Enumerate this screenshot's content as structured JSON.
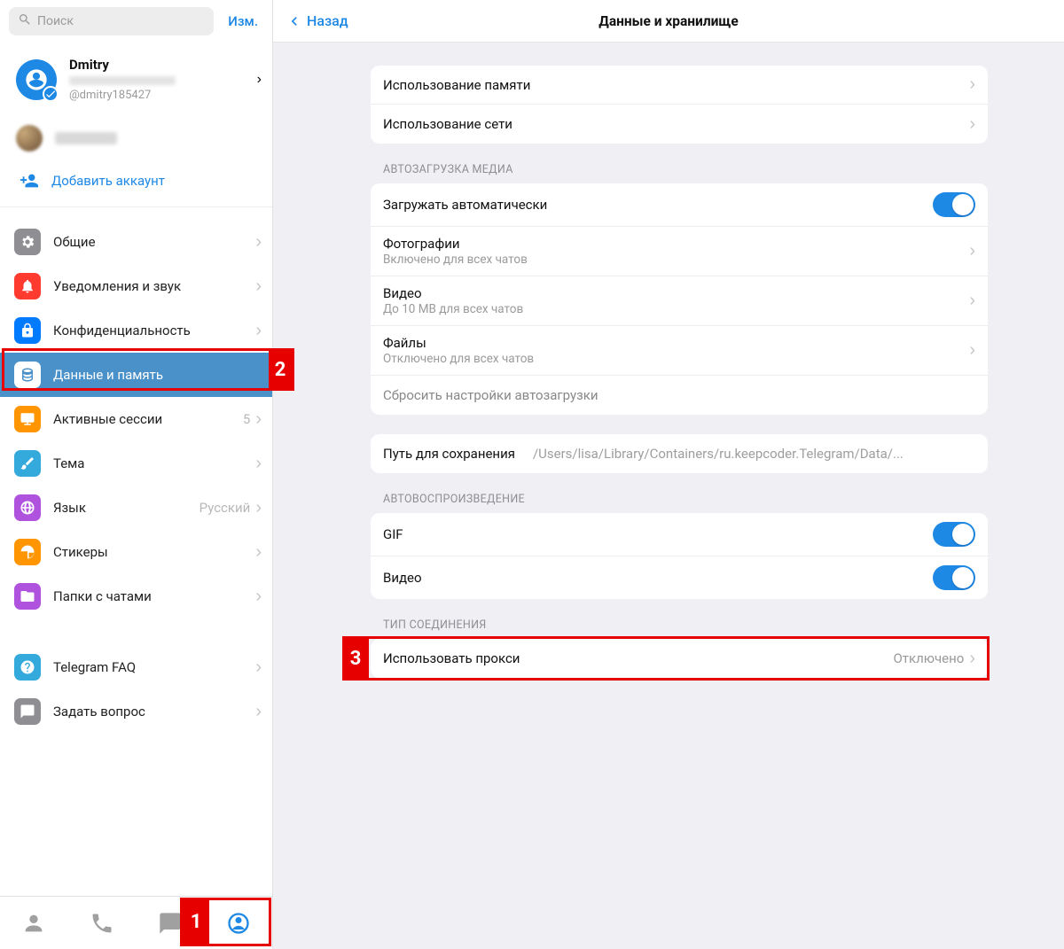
{
  "sidebar": {
    "search_placeholder": "Поиск",
    "edit": "Изм.",
    "profile": {
      "name": "Dmitry",
      "handle": "@dmitry185427"
    },
    "add_account": "Добавить аккаунт",
    "items": [
      {
        "label": "Общие"
      },
      {
        "label": "Уведомления и звук"
      },
      {
        "label": "Конфиденциальность"
      },
      {
        "label": "Данные и память"
      },
      {
        "label": "Активные сессии",
        "value": "5"
      },
      {
        "label": "Тема"
      },
      {
        "label": "Язык",
        "value": "Русский"
      },
      {
        "label": "Стикеры"
      },
      {
        "label": "Папки с чатами"
      }
    ],
    "items2": [
      {
        "label": "Telegram FAQ"
      },
      {
        "label": "Задать вопрос"
      }
    ]
  },
  "main": {
    "back": "Назад",
    "title": "Данные и хранилище",
    "storage_usage": "Использование памяти",
    "network_usage": "Использование сети",
    "sec_autodownload": "АВТОЗАГРУЗКА МЕДИА",
    "autodownload": "Загружать автоматически",
    "photos": {
      "label": "Фотографии",
      "sub": "Включено для всех чатов"
    },
    "videos": {
      "label": "Видео",
      "sub": "До 10 MB для всех чатов"
    },
    "files": {
      "label": "Файлы",
      "sub": "Отключено для всех чатов"
    },
    "reset": "Сбросить настройки автозагрузки",
    "savepath": {
      "label": "Путь для сохранения",
      "value": "/Users/lisa/Library/Containers/ru.keepcoder.Telegram/Data/..."
    },
    "sec_autoplay": "АВТОВОСПРОИЗВЕДЕНИЕ",
    "gif": "GIF",
    "video": "Видео",
    "sec_conn": "ТИП СОЕДИНЕНИЯ",
    "proxy": {
      "label": "Использовать прокси",
      "value": "Отключено"
    }
  },
  "annotations": {
    "n1": "1",
    "n2": "2",
    "n3": "3"
  }
}
